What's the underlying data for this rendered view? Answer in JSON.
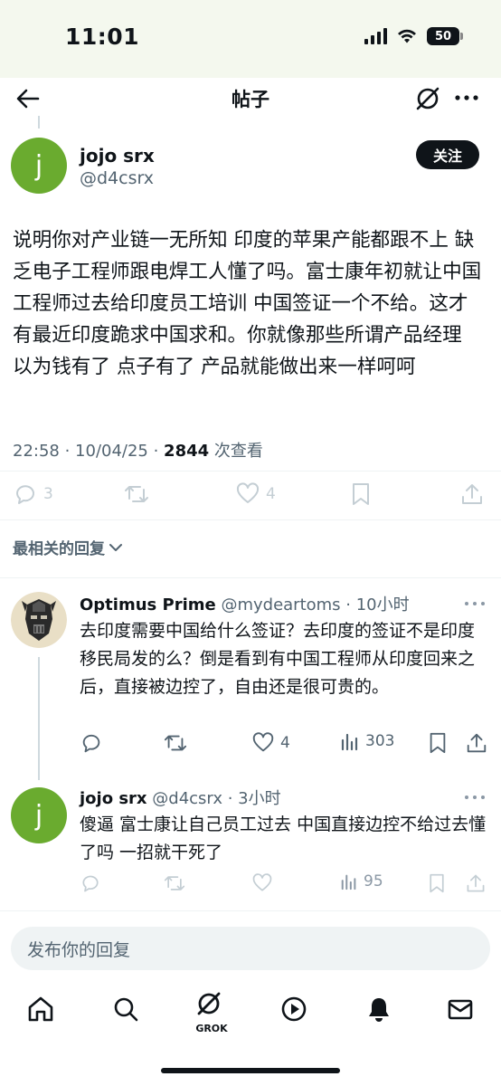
{
  "status_bar": {
    "time": "11:01",
    "battery": "50"
  },
  "nav": {
    "title": "帖子"
  },
  "post": {
    "author_name": "jojo srx",
    "author_handle": "@d4csrx",
    "avatar_letter": "j",
    "follow_label": "关注",
    "text": "说明你对产业链一无所知 印度的苹果产能都跟不上 缺乏电子工程师跟电焊工人懂了吗。富士康年初就让中国工程师过去给印度员工培训 中国签证一个不给。这才有最近印度跪求中国求和。你就像那些所谓产品经理 以为钱有了 点子有了 产品就能做出来一样呵呵",
    "time": "22:58 · 10/04/25 · ",
    "views_count": "2844",
    "views_label": " 次查看",
    "reply_count": "3",
    "like_count": "4"
  },
  "sort": {
    "label": "最相关的回复"
  },
  "replies": [
    {
      "name": "Optimus Prime",
      "handle": "@mydeartoms · 10小时",
      "text": "去印度需要中国给什么签证？去印度的签证不是印度移民局发的么？倒是看到有中国工程师从印度回来之后，直接被边控了，自由还是很可贵的。",
      "like_count": "4",
      "view_count": "303"
    },
    {
      "name": "jojo srx",
      "handle": "@d4csrx · 3小时",
      "avatar_letter": "j",
      "text": "傻逼 富士康让自己员工过去 中国直接边控不给过去懂了吗 一招就干死了",
      "view_count": "95"
    }
  ],
  "compose": {
    "placeholder": "发布你的回复"
  },
  "tabbar": {
    "grok_label": "GROK"
  },
  "colors": {
    "accent": "#0f1419",
    "muted": "#536471",
    "avatar_green": "#6aab2f",
    "status_bg": "#f4f8ee"
  }
}
